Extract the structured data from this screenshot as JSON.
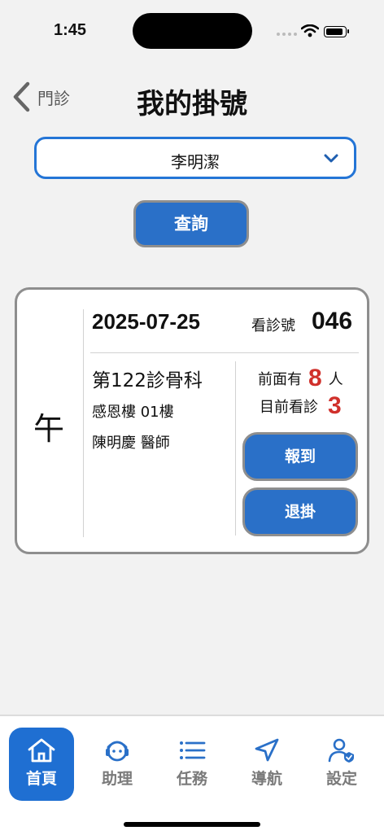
{
  "status": {
    "time": "1:45"
  },
  "header": {
    "back_label": "門診",
    "title": "我的掛號"
  },
  "patient_select": {
    "value": "李明潔"
  },
  "query_button": "查詢",
  "appointment": {
    "period": "午",
    "date": "2025-07-25",
    "visit_label": "看診號",
    "visit_number": "046",
    "department": "第122診骨科",
    "building": "感恩樓 01樓",
    "doctor": "陳明慶 醫師",
    "ahead_label": "前面有",
    "ahead_count": "8",
    "ahead_unit": "人",
    "current_label": "目前看診",
    "current_number": "3",
    "checkin_button": "報到",
    "cancel_button": "退掛"
  },
  "tabs": [
    {
      "label": "首頁",
      "icon": "home-icon",
      "active": true
    },
    {
      "label": "助理",
      "icon": "assistant-icon",
      "active": false
    },
    {
      "label": "任務",
      "icon": "list-icon",
      "active": false
    },
    {
      "label": "導航",
      "icon": "navigation-icon",
      "active": false
    },
    {
      "label": "設定",
      "icon": "user-settings-icon",
      "active": false
    }
  ],
  "colors": {
    "accent": "#2a70c8",
    "highlight": "#d0302b",
    "select_border": "#2475d6"
  }
}
